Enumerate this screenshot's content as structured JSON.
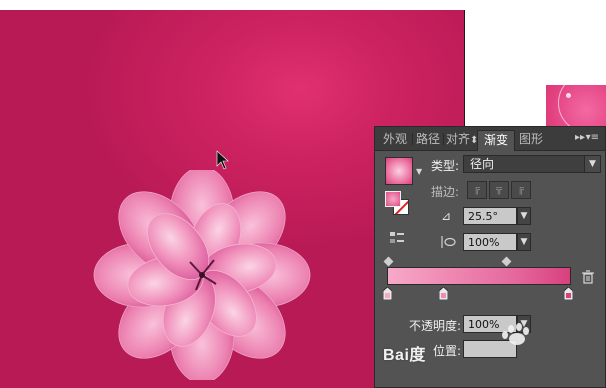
{
  "panel": {
    "tabs": [
      {
        "label": "外观"
      },
      {
        "label": "路径"
      },
      {
        "label": "对齐"
      },
      {
        "label": "渐变"
      },
      {
        "label": "图形"
      }
    ],
    "active_tab": "渐变",
    "collapse_glyph": "▸▸",
    "menu_glyph": "▾≡",
    "type": {
      "label": "类型:",
      "value": "径向"
    },
    "stroke": {
      "label": "描边:"
    },
    "angle": {
      "value": "25.5°"
    },
    "aspect": {
      "value": "100%"
    },
    "opacity": {
      "label": "不透明度:",
      "value": "100%"
    },
    "location": {
      "label": "位置:",
      "value": ""
    },
    "gradient_stops": [
      {
        "position": 0.0,
        "color": "#f7a9c8"
      },
      {
        "position": 0.3,
        "color": "#ef8ab4"
      },
      {
        "position": 1.0,
        "color": "#d8407c"
      }
    ],
    "gradient_midpoints": [
      0.0,
      0.65
    ]
  },
  "colors": {
    "artboard": "#cc2260",
    "panel_bg": "#535353",
    "tab_bar_bg": "#3c3c3c"
  },
  "watermark": {
    "text": "Bai度"
  }
}
